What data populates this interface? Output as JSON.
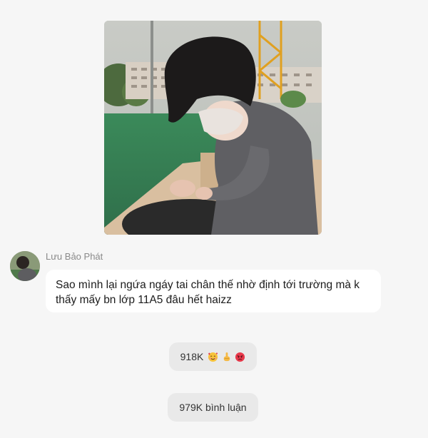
{
  "post": {
    "photo_icon": "photo-person-in-mask-sitting-on-bleachers"
  },
  "message": {
    "sender_name": "Lưu Bảo Phát",
    "avatar_icon": "avatar-person-photo",
    "text": "Sao mình lại ngứa ngáy tai chân thế nhờ định tới trường mà k thấy mấy bn lớp 11A5 đâu hết haizz"
  },
  "reactions": {
    "count": "918K",
    "icons": [
      "smiling-face-with-hearts-icon",
      "middle-finger-icon",
      "angry-face-icon"
    ]
  },
  "comments": {
    "label": "979K bình luận"
  },
  "colors": {
    "background": "#f6f6f6",
    "bubble": "#ffffff",
    "pill": "#e9e9e9",
    "name": "#8a8a8a"
  }
}
